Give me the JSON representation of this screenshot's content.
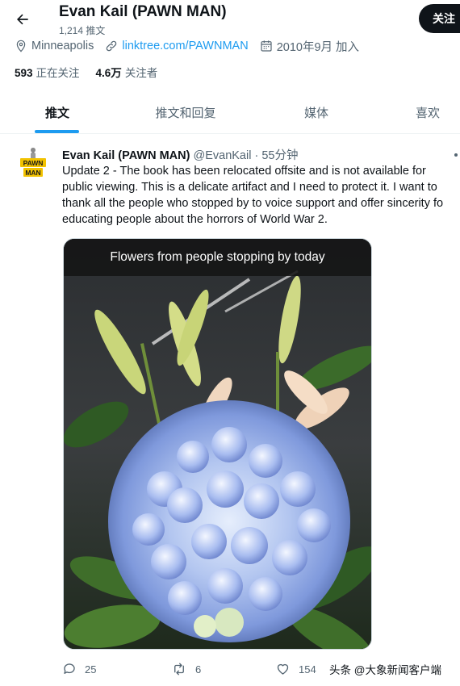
{
  "header": {
    "title": "Evan Kail (PAWN MAN)",
    "subtitle": "1,214 推文",
    "follow_label": "关注"
  },
  "profile": {
    "location": "Minneapolis",
    "link": "linktree.com/PAWNMAN",
    "joined": "2010年9月 加入",
    "following_count": "593",
    "following_label": "正在关注",
    "followers_count": "4.6万",
    "followers_label": "关注者"
  },
  "tabs": [
    {
      "label": "推文",
      "active": true
    },
    {
      "label": "推文和回复",
      "active": false
    },
    {
      "label": "媒体",
      "active": false
    },
    {
      "label": "喜欢",
      "active": false
    }
  ],
  "tweet": {
    "author": "Evan Kail (PAWN MAN)",
    "handle": "@EvanKail",
    "separator": "·",
    "time": "55分钟",
    "avatar_text": "PAWN MAN",
    "text": "Update 2 - The book has been relocated offsite and is not available for\npublic viewing. This is a delicate artifact and I need to protect it. I want to\nthank all the people who stopped by to voice support and offer sincerity fo\neducating people about the horrors of World War 2.",
    "image_caption": "Flowers from people stopping by today",
    "replies": "25",
    "retweets": "6",
    "likes": "154"
  },
  "watermark": "头条 @大象新闻客户端",
  "colors": {
    "accent": "#1d9bf0",
    "text": "#0f1419",
    "secondary": "#536471"
  }
}
